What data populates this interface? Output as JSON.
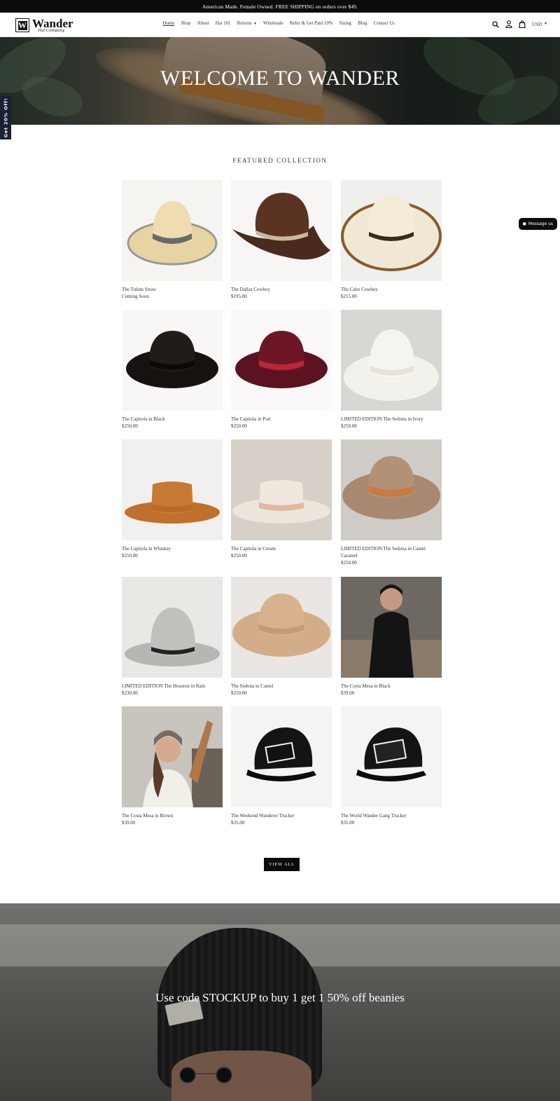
{
  "announcement": "American Made. Female Owned. FREE SHIPPING on orders over $49.",
  "logo": {
    "name": "Wander",
    "tagline": "Hat Company",
    "mark": "W"
  },
  "nav": {
    "items": [
      "Home",
      "Shop",
      "About",
      "Hat 101",
      "Returns",
      "Wholesale",
      "Refer & Get Paid 10%",
      "Sizing",
      "Blog",
      "Contact Us"
    ],
    "active": "Home"
  },
  "header": {
    "currency": "USD",
    "icons": [
      "search-icon",
      "account-icon",
      "cart-icon"
    ]
  },
  "hero": {
    "title": "WELCOME TO WANDER"
  },
  "side_tab": {
    "label": "Get 20% Off!"
  },
  "message_button": {
    "label": "Message us"
  },
  "featured": {
    "title": "FEATURED COLLECTION",
    "products": [
      {
        "title": "The Tulum Straw",
        "price": "Coming Soon"
      },
      {
        "title": "The Dallas Cowboy",
        "price": "$195.00"
      },
      {
        "title": "The Cabo Cowboy",
        "price": "$215.00"
      },
      {
        "title": "The Capitola in Black",
        "price": "$250.00"
      },
      {
        "title": "The Capitola in Port",
        "price": "$250.00"
      },
      {
        "title": "LIMITED EDITION The Sedona in Ivory",
        "price": "$250.00"
      },
      {
        "title": "The Capitola in Whiskey",
        "price": "$250.00"
      },
      {
        "title": "The Capitola in Cream",
        "price": "$250.00"
      },
      {
        "title": "LIMITED EDITION The Sedona in Camel Caramel",
        "price": "$250.00"
      },
      {
        "title": "LIMITED EDITION The Houston in Rain",
        "price": "$230.00"
      },
      {
        "title": "The Sedona in Camel",
        "price": "$250.00"
      },
      {
        "title": "The Costa Mesa in Black",
        "price": "$39.00"
      },
      {
        "title": "The Costa Mesa in Brown",
        "price": "$39.00"
      },
      {
        "title": "The Weekend Wanderer Trucker",
        "price": "$35.00"
      },
      {
        "title": "The World Wander Gang Trucker",
        "price": "$35.00"
      }
    ],
    "view_all": "VIEW ALL"
  },
  "promo": {
    "text": "Use code STOCKUP to buy 1 get 1 50% off beanies"
  },
  "colors": {
    "dark": "#0b0b0b",
    "side_tab": "#1b2135",
    "text": "#333333"
  }
}
